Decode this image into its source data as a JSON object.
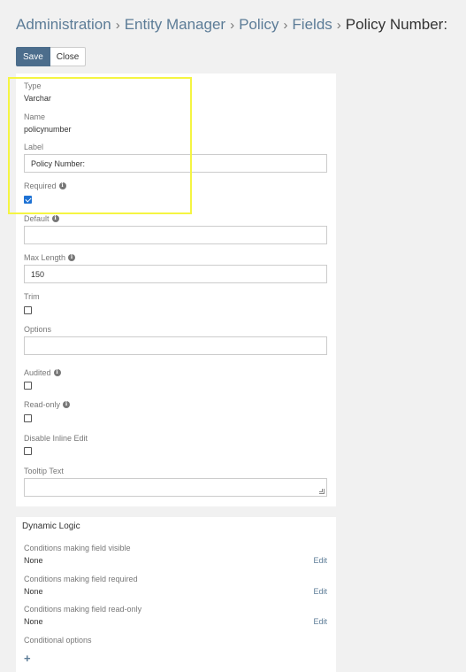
{
  "breadcrumb": {
    "items": [
      "Administration",
      "Entity Manager",
      "Policy",
      "Fields"
    ],
    "separator": "›",
    "current": "Policy Number:"
  },
  "toolbar": {
    "save_label": "Save",
    "close_label": "Close"
  },
  "fields": {
    "type_label": "Type",
    "type_value": "Varchar",
    "name_label": "Name",
    "name_value": "policynumber",
    "label_label": "Label",
    "label_value": "Policy Number:",
    "required_label": "Required",
    "required_checked": true,
    "default_label": "Default",
    "default_value": "",
    "max_length_label": "Max Length",
    "max_length_value": "150",
    "trim_label": "Trim",
    "trim_checked": false,
    "options_label": "Options",
    "options_value": "",
    "audited_label": "Audited",
    "audited_checked": false,
    "readonly_label": "Read-only",
    "readonly_checked": false,
    "disable_inline_label": "Disable Inline Edit",
    "disable_inline_checked": false,
    "tooltip_label": "Tooltip Text",
    "tooltip_value": ""
  },
  "dynamic_logic": {
    "title": "Dynamic Logic",
    "visible_label": "Conditions making field visible",
    "visible_value": "None",
    "required_label": "Conditions making field required",
    "required_value": "None",
    "readonly_label": "Conditions making field read-only",
    "readonly_value": "None",
    "conditional_options_label": "Conditional options",
    "edit_label": "Edit",
    "add_symbol": "+"
  },
  "colors": {
    "primary_button": "#4c6d8c",
    "link": "#5c7c97",
    "highlight": "#f5f542",
    "checkbox_checked": "#1e72d4"
  }
}
